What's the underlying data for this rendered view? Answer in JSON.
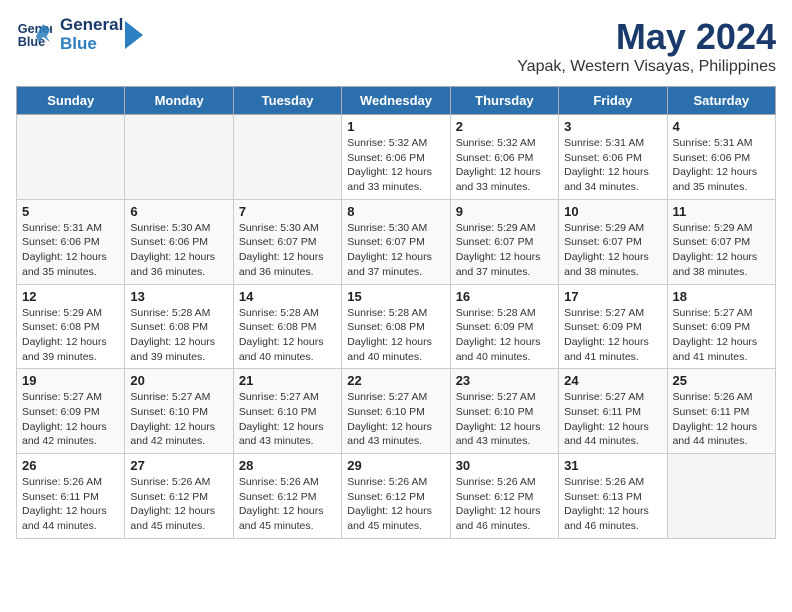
{
  "header": {
    "logo_line1": "General",
    "logo_line2": "Blue",
    "month_title": "May 2024",
    "location": "Yapak, Western Visayas, Philippines"
  },
  "weekdays": [
    "Sunday",
    "Monday",
    "Tuesday",
    "Wednesday",
    "Thursday",
    "Friday",
    "Saturday"
  ],
  "weeks": [
    [
      {
        "day": "",
        "empty": true
      },
      {
        "day": "",
        "empty": true
      },
      {
        "day": "",
        "empty": true
      },
      {
        "day": "1",
        "sunrise": "5:32 AM",
        "sunset": "6:06 PM",
        "daylight": "12 hours and 33 minutes."
      },
      {
        "day": "2",
        "sunrise": "5:32 AM",
        "sunset": "6:06 PM",
        "daylight": "12 hours and 33 minutes."
      },
      {
        "day": "3",
        "sunrise": "5:31 AM",
        "sunset": "6:06 PM",
        "daylight": "12 hours and 34 minutes."
      },
      {
        "day": "4",
        "sunrise": "5:31 AM",
        "sunset": "6:06 PM",
        "daylight": "12 hours and 35 minutes."
      }
    ],
    [
      {
        "day": "5",
        "sunrise": "5:31 AM",
        "sunset": "6:06 PM",
        "daylight": "12 hours and 35 minutes."
      },
      {
        "day": "6",
        "sunrise": "5:30 AM",
        "sunset": "6:06 PM",
        "daylight": "12 hours and 36 minutes."
      },
      {
        "day": "7",
        "sunrise": "5:30 AM",
        "sunset": "6:07 PM",
        "daylight": "12 hours and 36 minutes."
      },
      {
        "day": "8",
        "sunrise": "5:30 AM",
        "sunset": "6:07 PM",
        "daylight": "12 hours and 37 minutes."
      },
      {
        "day": "9",
        "sunrise": "5:29 AM",
        "sunset": "6:07 PM",
        "daylight": "12 hours and 37 minutes."
      },
      {
        "day": "10",
        "sunrise": "5:29 AM",
        "sunset": "6:07 PM",
        "daylight": "12 hours and 38 minutes."
      },
      {
        "day": "11",
        "sunrise": "5:29 AM",
        "sunset": "6:07 PM",
        "daylight": "12 hours and 38 minutes."
      }
    ],
    [
      {
        "day": "12",
        "sunrise": "5:29 AM",
        "sunset": "6:08 PM",
        "daylight": "12 hours and 39 minutes."
      },
      {
        "day": "13",
        "sunrise": "5:28 AM",
        "sunset": "6:08 PM",
        "daylight": "12 hours and 39 minutes."
      },
      {
        "day": "14",
        "sunrise": "5:28 AM",
        "sunset": "6:08 PM",
        "daylight": "12 hours and 40 minutes."
      },
      {
        "day": "15",
        "sunrise": "5:28 AM",
        "sunset": "6:08 PM",
        "daylight": "12 hours and 40 minutes."
      },
      {
        "day": "16",
        "sunrise": "5:28 AM",
        "sunset": "6:09 PM",
        "daylight": "12 hours and 40 minutes."
      },
      {
        "day": "17",
        "sunrise": "5:27 AM",
        "sunset": "6:09 PM",
        "daylight": "12 hours and 41 minutes."
      },
      {
        "day": "18",
        "sunrise": "5:27 AM",
        "sunset": "6:09 PM",
        "daylight": "12 hours and 41 minutes."
      }
    ],
    [
      {
        "day": "19",
        "sunrise": "5:27 AM",
        "sunset": "6:09 PM",
        "daylight": "12 hours and 42 minutes."
      },
      {
        "day": "20",
        "sunrise": "5:27 AM",
        "sunset": "6:10 PM",
        "daylight": "12 hours and 42 minutes."
      },
      {
        "day": "21",
        "sunrise": "5:27 AM",
        "sunset": "6:10 PM",
        "daylight": "12 hours and 43 minutes."
      },
      {
        "day": "22",
        "sunrise": "5:27 AM",
        "sunset": "6:10 PM",
        "daylight": "12 hours and 43 minutes."
      },
      {
        "day": "23",
        "sunrise": "5:27 AM",
        "sunset": "6:10 PM",
        "daylight": "12 hours and 43 minutes."
      },
      {
        "day": "24",
        "sunrise": "5:27 AM",
        "sunset": "6:11 PM",
        "daylight": "12 hours and 44 minutes."
      },
      {
        "day": "25",
        "sunrise": "5:26 AM",
        "sunset": "6:11 PM",
        "daylight": "12 hours and 44 minutes."
      }
    ],
    [
      {
        "day": "26",
        "sunrise": "5:26 AM",
        "sunset": "6:11 PM",
        "daylight": "12 hours and 44 minutes."
      },
      {
        "day": "27",
        "sunrise": "5:26 AM",
        "sunset": "6:12 PM",
        "daylight": "12 hours and 45 minutes."
      },
      {
        "day": "28",
        "sunrise": "5:26 AM",
        "sunset": "6:12 PM",
        "daylight": "12 hours and 45 minutes."
      },
      {
        "day": "29",
        "sunrise": "5:26 AM",
        "sunset": "6:12 PM",
        "daylight": "12 hours and 45 minutes."
      },
      {
        "day": "30",
        "sunrise": "5:26 AM",
        "sunset": "6:12 PM",
        "daylight": "12 hours and 46 minutes."
      },
      {
        "day": "31",
        "sunrise": "5:26 AM",
        "sunset": "6:13 PM",
        "daylight": "12 hours and 46 minutes."
      },
      {
        "day": "",
        "empty": true
      }
    ]
  ]
}
